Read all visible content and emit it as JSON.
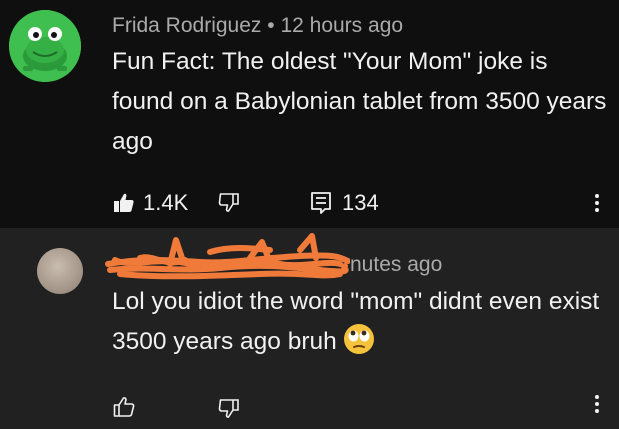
{
  "comment1": {
    "author": "Frida Rodriguez",
    "separator": "•",
    "time": "12 hours ago",
    "text": "Fun Fact: The oldest \"Your Mom\" joke is found on a Babylonian tablet from 3500 years ago",
    "likes": "1.4K",
    "replies": "134",
    "avatar_icon": "frog-avatar-icon",
    "avatar_color": "#3fbf4f"
  },
  "comment2": {
    "author_redacted": true,
    "time_partial": "nutes ago",
    "text": "Lol you idiot the word \"mom\" didnt even exist 3500 years ago bruh",
    "emoji_icon": "face-with-rolling-eyes-icon",
    "avatar_icon": "blurred-avatar-icon",
    "scribble_color": "#f07a3a"
  },
  "icons": {
    "like": "thumbs-up-icon",
    "dislike": "thumbs-down-icon",
    "reply": "comment-icon",
    "more": "kebab-menu-icon"
  }
}
